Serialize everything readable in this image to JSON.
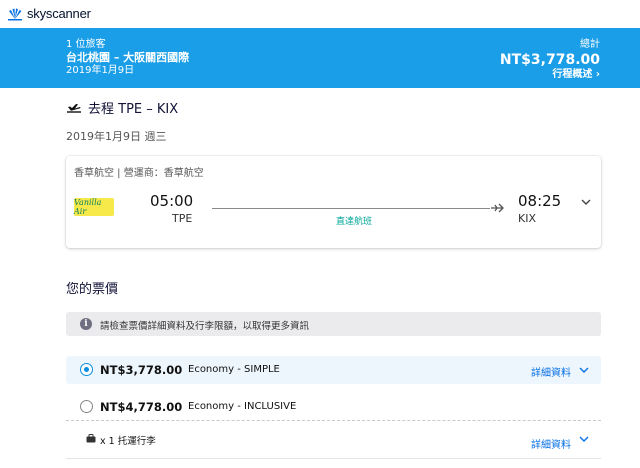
{
  "brand": {
    "name": "skyscanner"
  },
  "summary": {
    "travelers": "1 位旅客",
    "route": "台北桃園 – 大阪關西國際",
    "date": "2019年1月9日",
    "total_label": "總計",
    "total_price": "NT$3,778.00",
    "overview_link": "行程概述 ›"
  },
  "outbound": {
    "title": "去程 TPE – KIX",
    "date": "2019年1月9日 週三"
  },
  "flight": {
    "airline_line": "香草航空 | 營運商：香草航空",
    "logo_text": "Vanilla Air",
    "dep_time": "05:00",
    "dep_code": "TPE",
    "arr_time": "08:25",
    "arr_code": "KIX",
    "stops": "直達航班"
  },
  "fares": {
    "title": "您的票價",
    "info": "請檢查票價詳細資料及行李限額，以取得更多資訊",
    "options": [
      {
        "price": "NT$3,778.00",
        "class": "Economy - SIMPLE",
        "detail": "詳細資料",
        "selected": true
      },
      {
        "price": "NT$4,778.00",
        "class": "Economy - INCLUSIVE",
        "detail": "",
        "selected": false
      }
    ],
    "baggage": {
      "text": "x 1 托運行李",
      "detail": "詳細資料"
    }
  },
  "colors": {
    "header_blue": "#1a9ee8",
    "accent": "#0a8fe0",
    "direct_green": "#00a698",
    "link": "#0770e3"
  }
}
